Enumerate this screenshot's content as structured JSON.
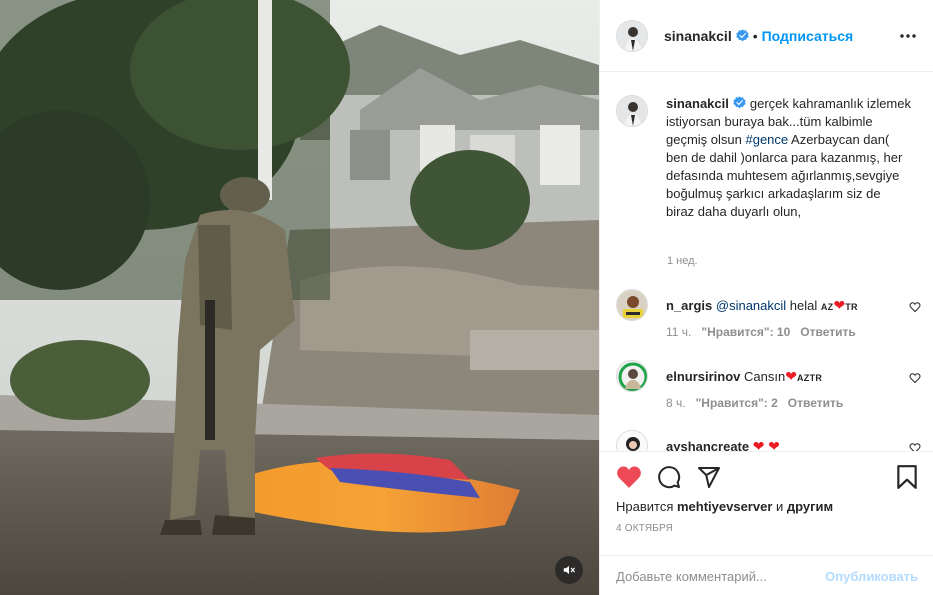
{
  "post": {
    "author": "sinanakcil",
    "follow_label": "Подписаться",
    "header_dot": "•"
  },
  "caption": {
    "username": "sinanakcil",
    "text_before_tag": "gerçek kahramanlık izlemek istiyorsan buraya bak...tüm kalbimle geçmiş olsun ",
    "hashtag": "#gence",
    "text_after_tag": " Azerbaycan dan( ben de dahil )onlarca para kazanmış, her defasında muhtesem ağırlanmış,sevgiye boğulmuş şarkıcı arkadaşlarım siz de biraz daha duyarlı olun,",
    "time": "1 нед."
  },
  "comments": [
    {
      "username": "n_argis",
      "mention": "@sinanakcil",
      "text": " helal ",
      "flag_left": "AZ",
      "flag_right": "TR",
      "time": "11 ч.",
      "likes": "\"Нравится\": 10",
      "reply": "Ответить"
    },
    {
      "username": "elnursirinov",
      "text": " Cansın",
      "flag_right": "AZTR",
      "time": "8 ч.",
      "likes": "\"Нравится\": 2",
      "reply": "Ответить"
    },
    {
      "username": "ayshancreate",
      "text": " "
    }
  ],
  "actions": {
    "likes_prefix": "Нравится ",
    "likes_user": "mehtiyevserver",
    "likes_mid": " и ",
    "likes_suffix": "другим",
    "date": "4 ОКТЯБРЯ",
    "comment_placeholder": "Добавьте комментарий...",
    "publish_label": "Опубликовать"
  },
  "colors": {
    "accent": "#0095f6",
    "like_red": "#ed4956",
    "link_dark": "#00376b",
    "muted": "#8e8e8e"
  },
  "icons": {
    "more": "more-horizontal-icon",
    "like": "heart-filled-icon",
    "comment": "comment-bubble-icon",
    "share": "paper-plane-icon",
    "save": "bookmark-icon",
    "mute": "speaker-muted-icon",
    "verified": "verified-badge-icon"
  }
}
